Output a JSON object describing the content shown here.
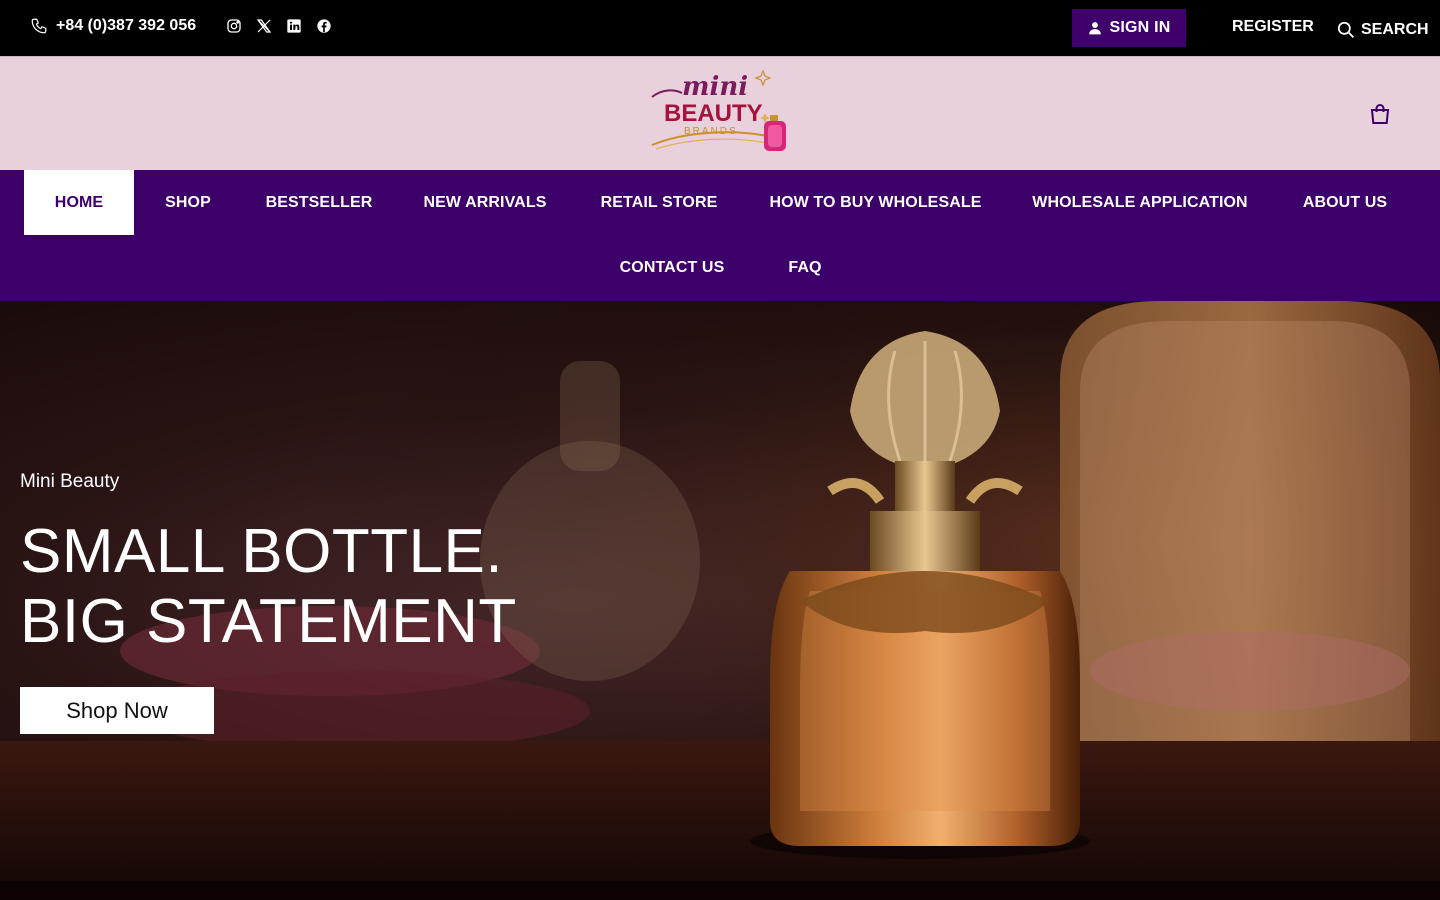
{
  "topbar": {
    "phone": "+84 (0)387 392 056",
    "social_icons": [
      "instagram-icon",
      "x-twitter-icon",
      "linkedin-icon",
      "facebook-icon"
    ],
    "signin_label": "SIGN IN",
    "register_label": "REGISTER",
    "search_label": "SEARCH"
  },
  "header": {
    "logo_text": [
      "mini",
      "BEAUTY",
      "BRANDS"
    ]
  },
  "nav": {
    "items": [
      {
        "label": "HOME"
      },
      {
        "label": "SHOP"
      },
      {
        "label": "BESTSELLER"
      },
      {
        "label": "NEW ARRIVALS"
      },
      {
        "label": "RETAIL STORE"
      },
      {
        "label": "HOW TO BUY WHOLESALE"
      },
      {
        "label": "WHOLESALE APPLICATION"
      },
      {
        "label": "ABOUT US"
      },
      {
        "label": "CONTACT US"
      },
      {
        "label": "FAQ"
      }
    ]
  },
  "hero": {
    "label": "Mini Beauty",
    "title_line1": "SMALL BOTTLE.",
    "title_line2": "BIG STATEMENT",
    "button_label": "Shop Now"
  },
  "colors": {
    "brand_purple": "#3d006b",
    "header_pink": "#e8d0dc",
    "topbar_black": "#000000"
  }
}
